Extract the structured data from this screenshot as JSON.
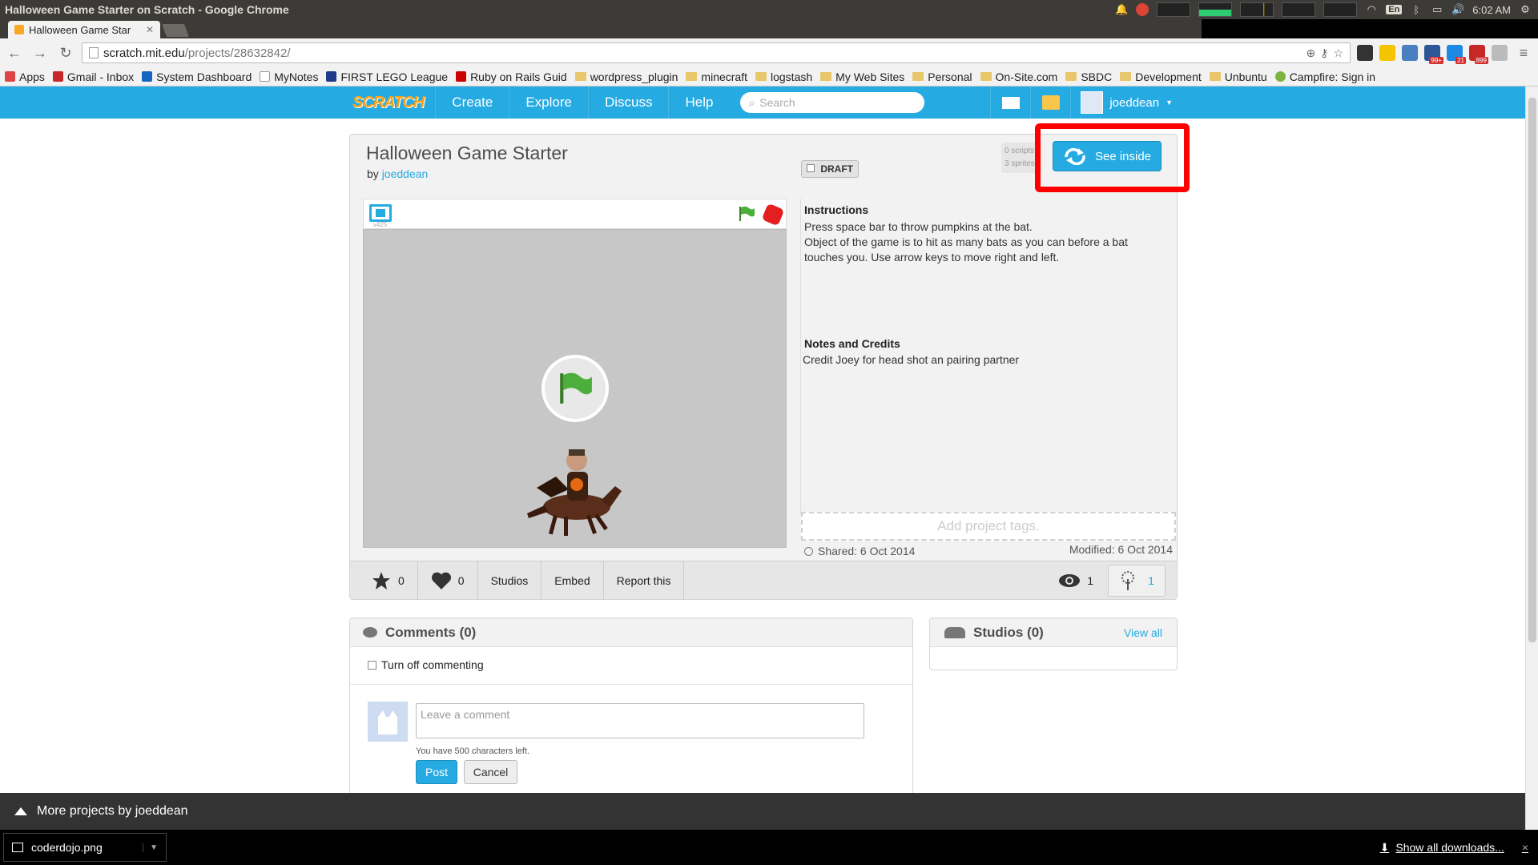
{
  "os": {
    "window_title": "Halloween Game Starter on Scratch - Google Chrome",
    "lang": "En",
    "time": "6:02 AM"
  },
  "browser": {
    "tab_title": "Halloween Game Star",
    "url_host": "scratch.mit.edu",
    "url_path": "/projects/28632842/",
    "ext_badges": [
      "99+",
      "21",
      "899"
    ],
    "bookmarks": [
      {
        "label": "Apps",
        "kind": "apps"
      },
      {
        "label": "Gmail - Inbox",
        "kind": "gmail"
      },
      {
        "label": "System Dashboard",
        "kind": "page"
      },
      {
        "label": "MyNotes",
        "kind": "page"
      },
      {
        "label": "FIRST LEGO League",
        "kind": "page"
      },
      {
        "label": "Ruby on Rails Guid",
        "kind": "page"
      },
      {
        "label": "wordpress_plugin",
        "kind": "folder"
      },
      {
        "label": "minecraft",
        "kind": "folder"
      },
      {
        "label": "logstash",
        "kind": "folder"
      },
      {
        "label": "My Web Sites",
        "kind": "folder"
      },
      {
        "label": "Personal",
        "kind": "folder"
      },
      {
        "label": "On-Site.com",
        "kind": "folder"
      },
      {
        "label": "SBDC",
        "kind": "folder"
      },
      {
        "label": "Development",
        "kind": "folder"
      },
      {
        "label": "Unbuntu",
        "kind": "folder"
      },
      {
        "label": "Campfire: Sign in",
        "kind": "page"
      }
    ]
  },
  "scratch_header": {
    "logo": "SCRATCH",
    "nav": [
      "Create",
      "Explore",
      "Discuss",
      "Help"
    ],
    "search_placeholder": "Search",
    "username": "joeddean"
  },
  "project": {
    "title": "Halloween Game Starter",
    "by_label": "by",
    "author": "joeddean",
    "draft_label": "DRAFT",
    "stats_mini": [
      "0 scripts",
      "3 sprites"
    ],
    "see_inside_label": "See inside",
    "player_version": "v425",
    "instructions_heading": "Instructions",
    "instructions_text": "Press space bar to throw pumpkins at the bat.\nObject of the game is to hit as many bats as you can before a bat touches you.  Use arrow keys to move right and left.",
    "notes_heading": "Notes and Credits",
    "notes_text": "Credit Joey for head shot an pairing partner",
    "tags_placeholder": "Add project tags.",
    "shared": "Shared: 6 Oct 2014",
    "modified": "Modified: 6 Oct 2014",
    "loves": "0",
    "favorites": "0",
    "studios_label": "Studios",
    "embed_label": "Embed",
    "report_label": "Report this",
    "views": "1",
    "remixes": "1"
  },
  "comments": {
    "heading": "Comments (0)",
    "turn_off_label": "Turn off commenting",
    "input_placeholder": "Leave a comment",
    "chars_left": "You have 500 characters left.",
    "post_label": "Post",
    "cancel_label": "Cancel"
  },
  "studios": {
    "heading": "Studios (0)",
    "view_all": "View all"
  },
  "more_projects": "More projects by joeddean",
  "downloads": {
    "file_name": "coderdojo.png",
    "show_all": "Show all downloads...",
    "close": "×"
  },
  "colors": {
    "scratch_blue": "#25aae1",
    "highlight_red": "#ff0000"
  }
}
